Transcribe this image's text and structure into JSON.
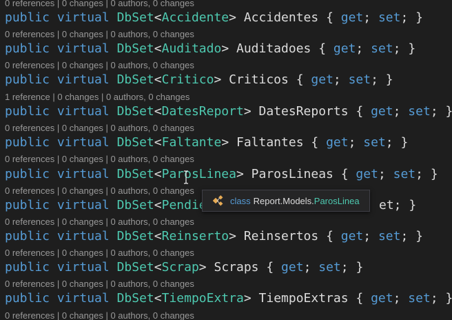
{
  "code_lens": {
    "l0": "0 references | 0 changes | 0 authors, 0 changes",
    "l1": "0 references | 0 changes | 0 authors, 0 changes",
    "l2": "0 references | 0 changes | 0 authors, 0 changes",
    "l3": "1 reference | 0 changes | 0 authors, 0 changes",
    "l4": "0 references | 0 changes | 0 authors, 0 changes",
    "l5": "0 references | 0 changes | 0 authors, 0 changes",
    "l6": "0 references | 0 changes | 0 authors, 0 changes",
    "l7": "0 references | 0 changes | 0 authors, 0 changes",
    "l8": "0 references | 0 changes | 0 authors, 0 changes",
    "l9": "0 references | 0 changes | 0 authors, 0 changes",
    "l10": "0 references | 0 changes | 0 authors, 0 changes"
  },
  "code": {
    "kw_public": "public",
    "kw_virtual": "virtual",
    "dbset": "DbSet",
    "lt": "<",
    "gt": ">",
    "open_brace": "{",
    "close_brace": "}",
    "get": "get",
    "set": "set",
    "semi": ";",
    "lines": [
      {
        "entity": "Accidente",
        "prop": "Accidentes"
      },
      {
        "entity": "Auditado",
        "prop": "Auditadoes"
      },
      {
        "entity": "Critico",
        "prop": "Criticos"
      },
      {
        "entity": "DatesReport",
        "prop": "DatesReports"
      },
      {
        "entity": "Faltante",
        "prop": "Faltantes"
      },
      {
        "entity": "ParosLinea",
        "prop": "ParosLineas"
      },
      {
        "entity": "Pendie",
        "prop": "et; }"
      },
      {
        "entity": "Reinserto",
        "prop": "Reinsertos"
      },
      {
        "entity": "Scrap",
        "prop": "Scraps"
      },
      {
        "entity": "TiempoExtra",
        "prop": "TiempoExtras"
      }
    ]
  },
  "tooltip": {
    "keyword": "class",
    "namespace": "Report.Models.",
    "type_name": "ParosLinea",
    "icon": "class-icon"
  },
  "colors": {
    "background": "#1e1e1e",
    "keyword": "#569cd6",
    "type": "#4ec9b0",
    "text": "#dcdcdc",
    "codelens": "#999999"
  }
}
